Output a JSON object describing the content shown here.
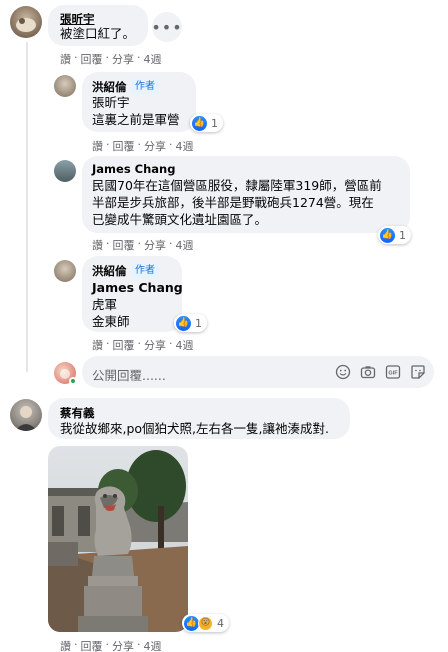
{
  "comments": [
    {
      "author": "張昕宇",
      "text": "被塗口紅了。",
      "more": "•••",
      "actions": {
        "like": "讚",
        "reply": "回覆",
        "share": "分享",
        "time": "4週"
      }
    },
    {
      "author": "洪紹倫",
      "badge": "作者",
      "lines": [
        "張昕宇",
        "這裏之前是軍營"
      ],
      "reaction_count": "1",
      "actions": {
        "like": "讚",
        "reply": "回覆",
        "share": "分享",
        "time": "4週"
      }
    },
    {
      "author": "James Chang",
      "lines": [
        "民國70年在這個營區服役，隸屬陸軍319師，營區前",
        "半部是步兵旅部，後半部是野戰砲兵1274營。現在",
        "已變成牛驚頭文化遺址園區了。"
      ],
      "reaction_count": "1",
      "actions": {
        "like": "讚",
        "reply": "回覆",
        "share": "分享",
        "time": "4週"
      }
    },
    {
      "author": "洪紹倫",
      "badge": "作者",
      "lines": [
        "James Chang",
        "虎軍",
        "金東師"
      ],
      "reaction_count": "1",
      "actions": {
        "like": "讚",
        "reply": "回覆",
        "share": "分享",
        "time": "4週"
      }
    },
    {
      "author": "蔡有義",
      "text": "我從故鄉來,po個狛犬照,左右各一隻,讓祂湊成對.",
      "reaction_count": "4",
      "actions": {
        "like": "讚",
        "reply": "回覆",
        "share": "分享",
        "time": "4週"
      }
    }
  ],
  "reply_box": {
    "placeholder": "公開回覆......"
  },
  "icons": [
    "smile-icon",
    "camera-icon",
    "gif-icon",
    "sticker-icon"
  ],
  "colors": {
    "bubble": "#f0f2f5",
    "like_blue": "#0866ff",
    "badge_bg": "#e7f3ff",
    "badge_text": "#1b74e4",
    "meta": "#65676b"
  }
}
